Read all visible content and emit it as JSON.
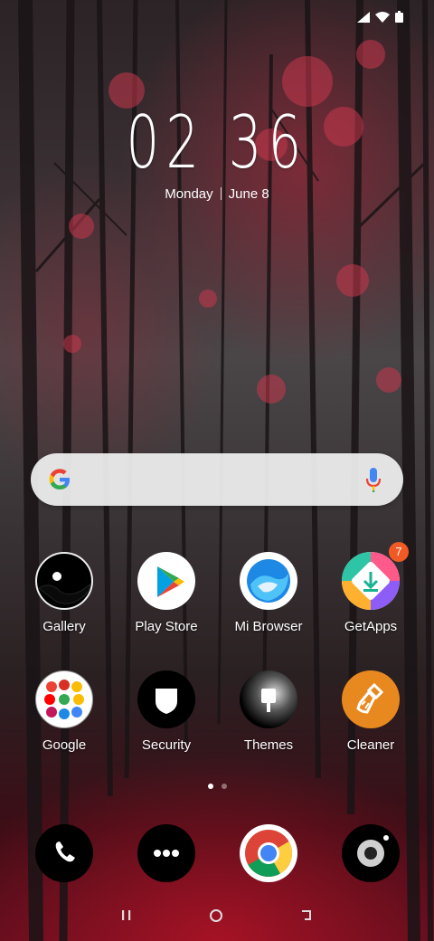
{
  "status_bar": {
    "icons": [
      "signal-icon",
      "wifi-icon",
      "battery-icon"
    ]
  },
  "clock": {
    "time": "02 36",
    "day": "Monday",
    "date": "June 8"
  },
  "search_bar": {
    "icons": [
      "google-logo",
      "mic-icon"
    ]
  },
  "apps": [
    {
      "label": "Gallery"
    },
    {
      "label": "Play Store"
    },
    {
      "label": "Mi Browser"
    },
    {
      "label": "GetApps",
      "badge": "7"
    },
    {
      "label": "Google"
    },
    {
      "label": "Security"
    },
    {
      "label": "Themes"
    },
    {
      "label": "Cleaner"
    }
  ],
  "page_indicator": {
    "pages": 2,
    "current": 1
  },
  "dock": [
    "phone-icon",
    "messaging-icon",
    "chrome-icon",
    "camera-icon"
  ],
  "nav_bar": [
    "recents-button",
    "home-button",
    "back-button"
  ],
  "colors": {
    "badge": "#f15a24",
    "cleaner": "#e8891f",
    "browser": "#1e88e5"
  }
}
